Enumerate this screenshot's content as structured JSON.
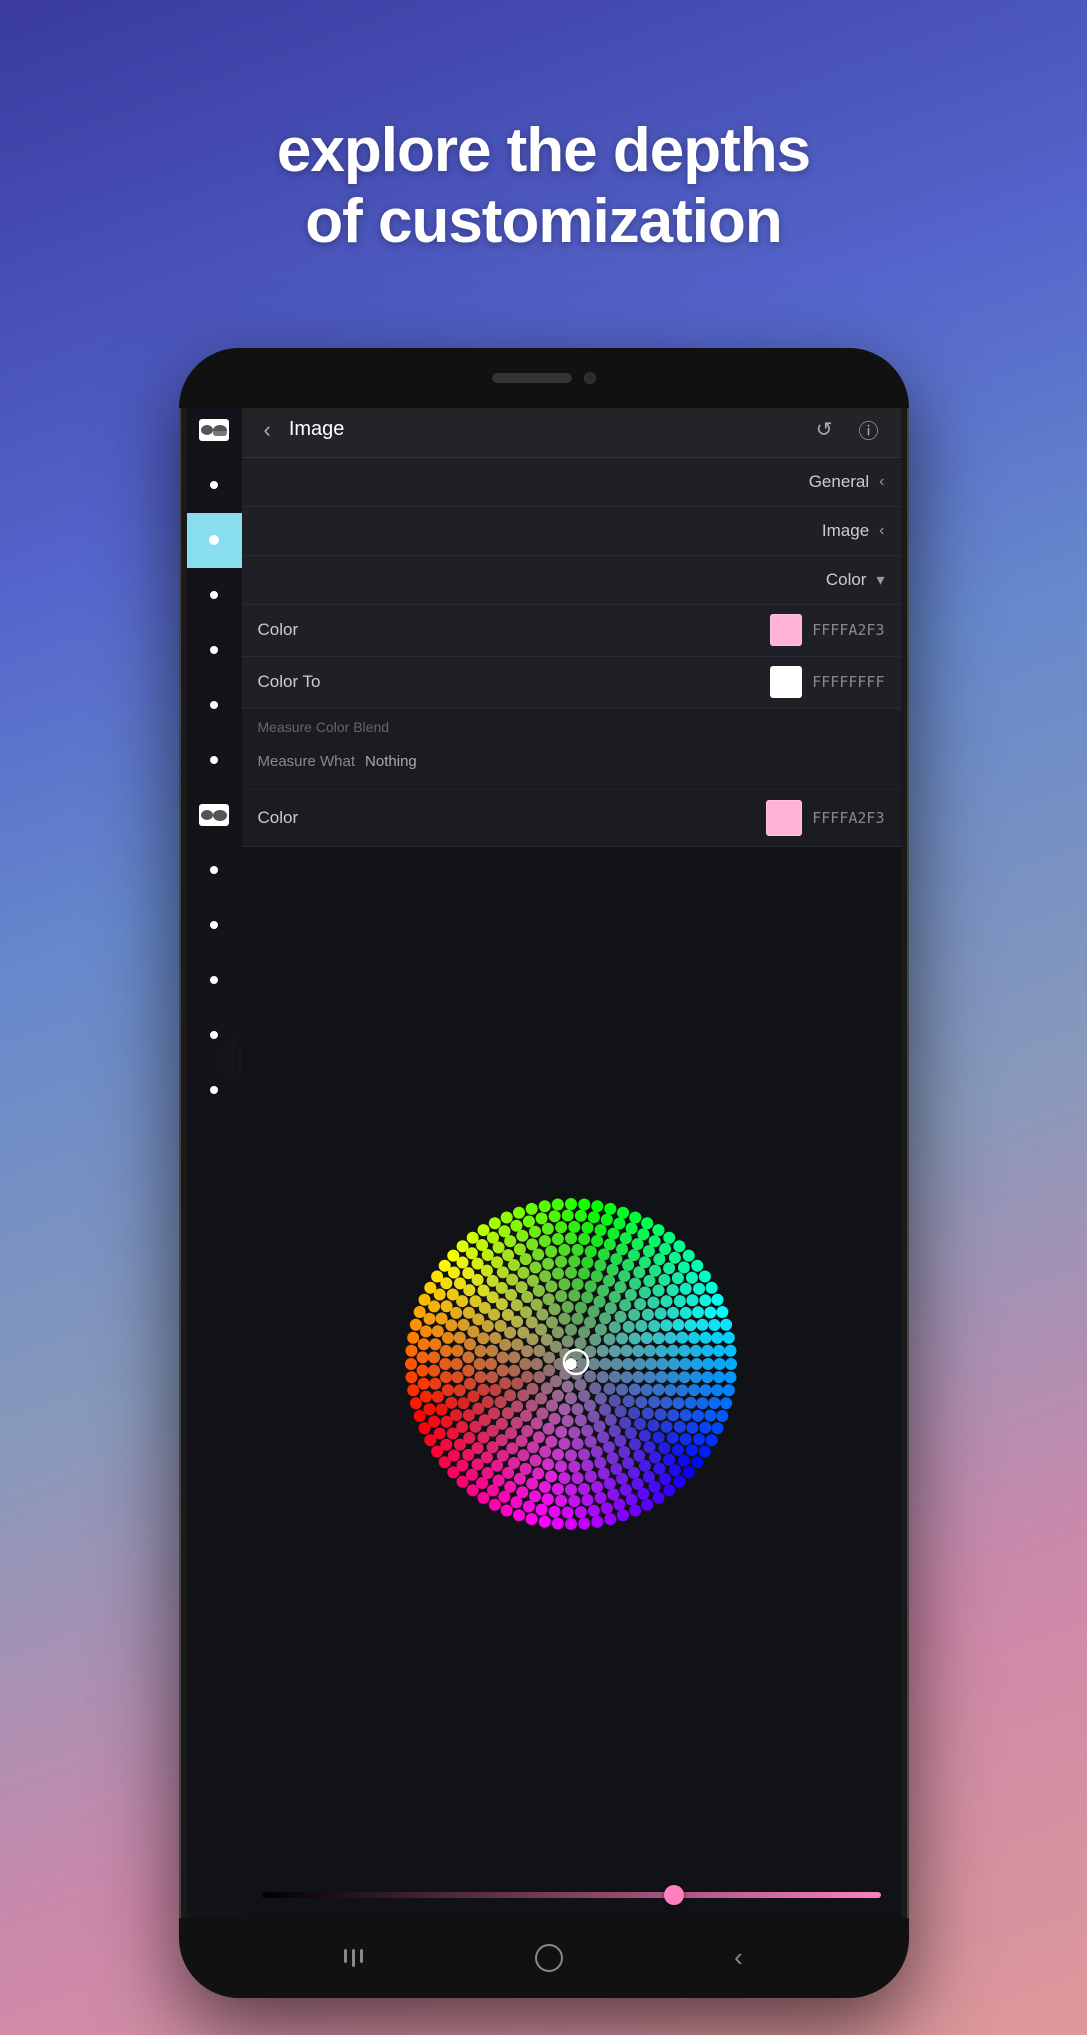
{
  "header": {
    "line1": "explore the depths",
    "line2": "of customization"
  },
  "phone": {
    "topbar": {
      "back_label": "‹",
      "title": "Image",
      "reset_label": "↺",
      "info_label": "ⓘ"
    },
    "sections": {
      "general_label": "General",
      "image_label": "Image",
      "color_dropdown_label": "Color"
    },
    "color_rows": [
      {
        "label": "Color",
        "swatch_color": "#ffb3d9",
        "hex_value": "FFFFA2F3"
      },
      {
        "label": "Color To",
        "swatch_color": "#ffffff",
        "hex_value": "FFFFFFFF"
      }
    ],
    "measure_section": {
      "title": "Measure Color Blend",
      "measure_what_label": "Measure What",
      "measure_what_value": "Nothing"
    },
    "color_picker": {
      "label": "Color",
      "swatch_color": "#ffb3d9",
      "hex_value": "FFFFA2F3"
    },
    "nav": {
      "back_label": "‹"
    }
  }
}
